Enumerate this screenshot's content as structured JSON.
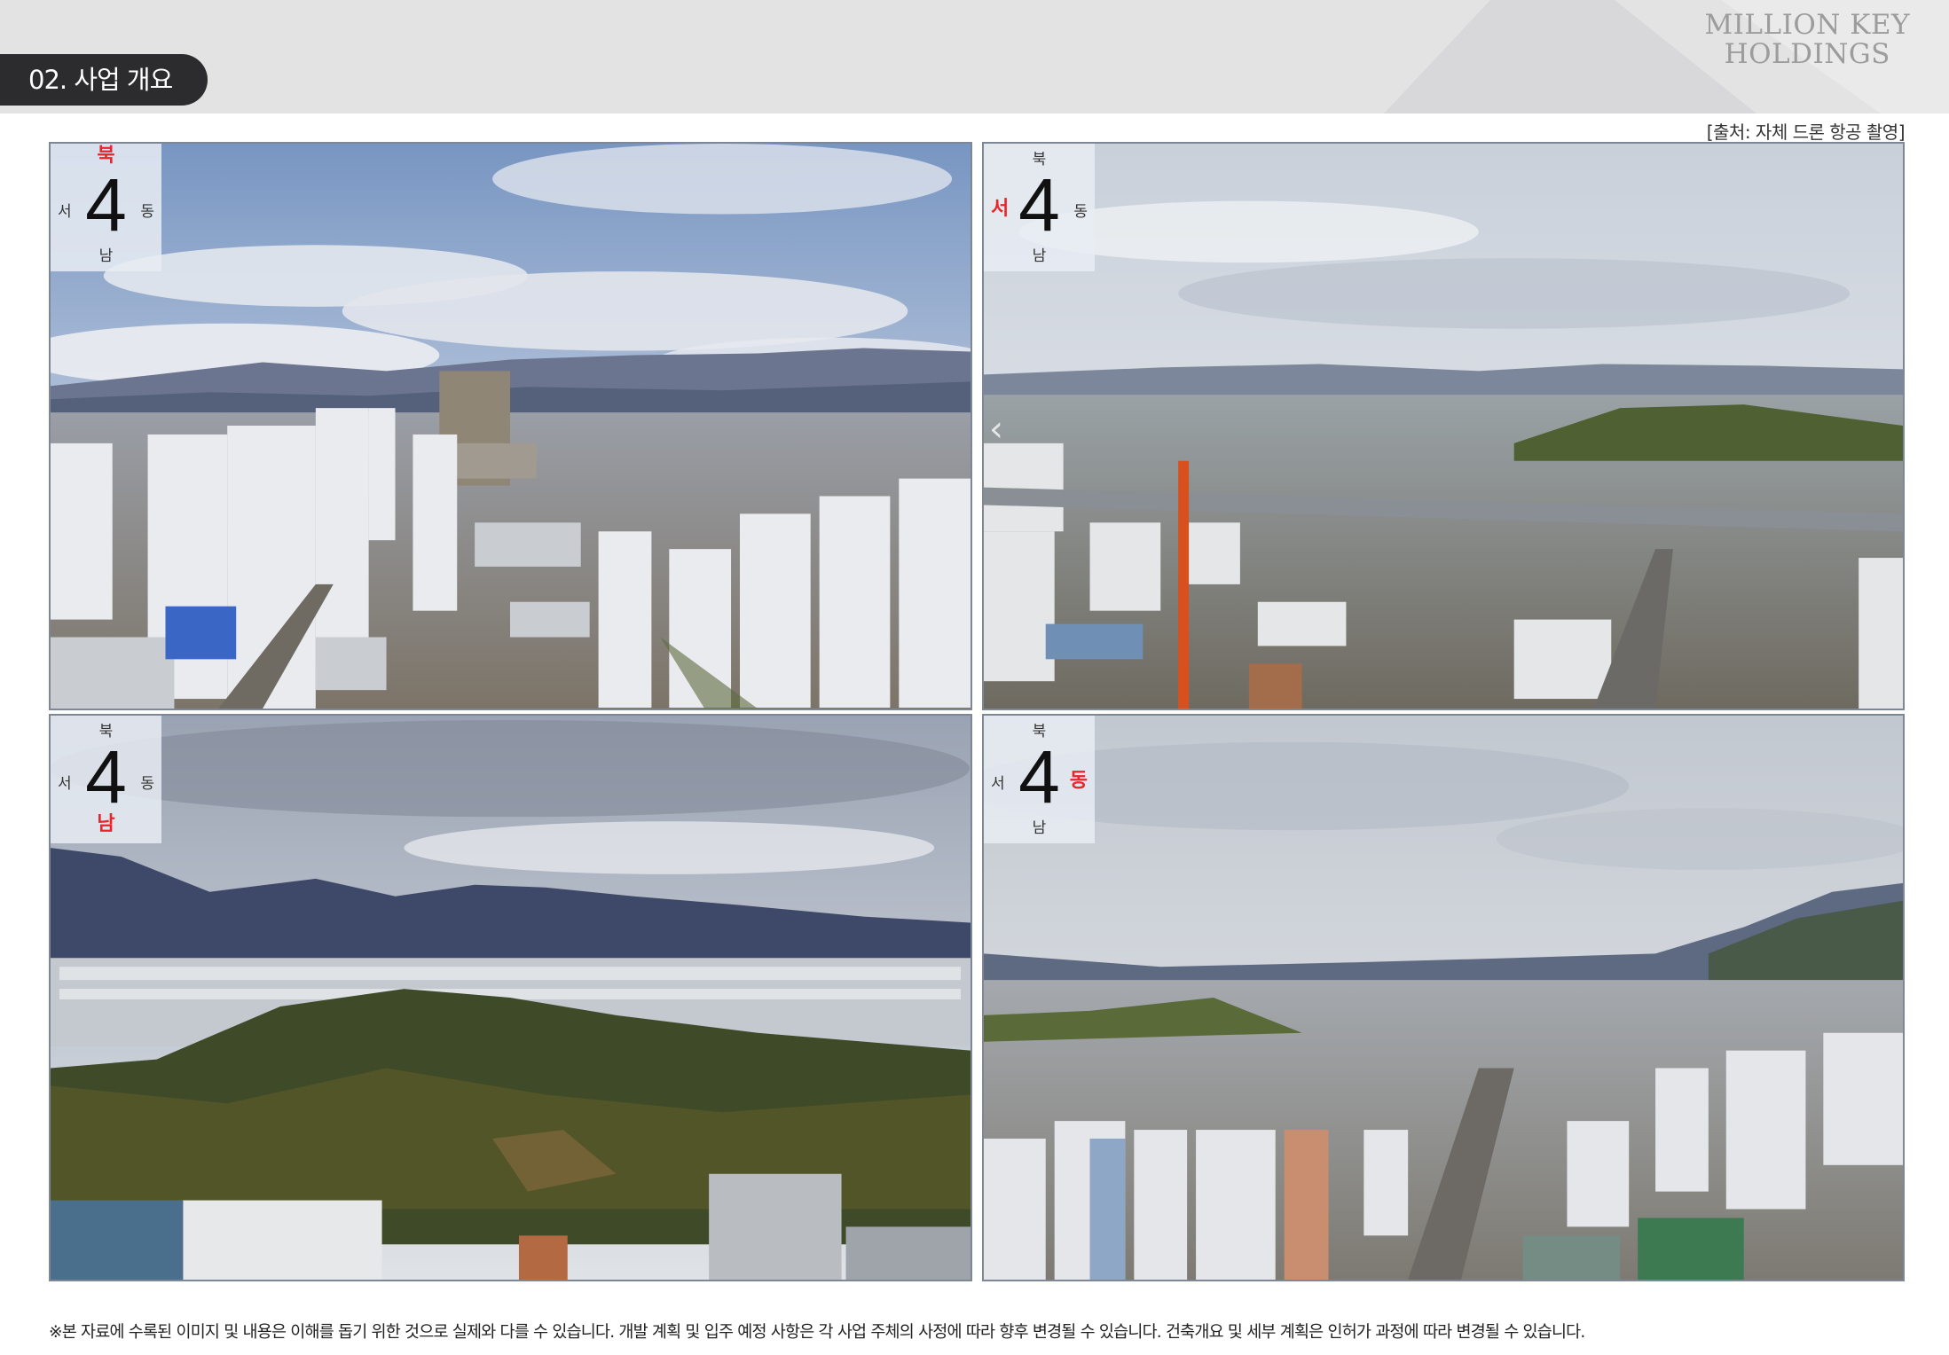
{
  "header": {
    "section_tab": "02. 사업 개요",
    "brand_line1": "MILLION KEY",
    "brand_line2": "HOLDINGS"
  },
  "source_note": "[출처: 자체 드론 항공 촬영]",
  "compass_labels": {
    "north": "북",
    "south": "남",
    "west": "서",
    "east": "동",
    "numeral": "4"
  },
  "photos": [
    {
      "active_direction": "north"
    },
    {
      "active_direction": "west"
    },
    {
      "active_direction": "south"
    },
    {
      "active_direction": "east"
    }
  ],
  "nav_arrow": "‹",
  "disclaimer": "※본 자료에 수록된 이미지 및 내용은 이해를 돕기 위한 것으로 실제와 다를 수 있습니다. 개발 계획 및 입주 예정 사항은 각 사업 주체의 사정에 따라 향후 변경될 수 있습니다. 건축개요 및 세부 계획은 인허가 과정에 따라 변경될 수 있습니다.",
  "colors": {
    "header_bg": "#e3e3e4",
    "tab_bg": "#2c2c2e",
    "active_direction": "#e8262a",
    "photo_border": "#7e8795"
  }
}
